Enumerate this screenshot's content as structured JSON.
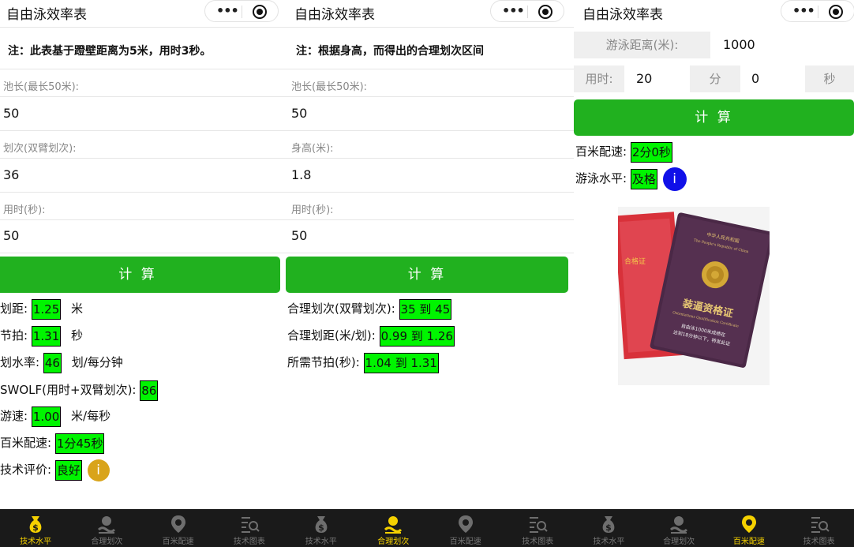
{
  "app_title": "自由泳效率表",
  "capsule": {
    "more_glyph": "•••"
  },
  "colors": {
    "accent_green": "#21b11f",
    "result_green": "#00f500",
    "tab_active": "#f5d100",
    "info_gold": "#d9a41a",
    "info_blue": "#1010e8"
  },
  "screen1": {
    "note": "注：此表基于蹬壁距离为5米，用时3秒。",
    "fields": [
      {
        "label": "池长(最长50米):",
        "value": "50"
      },
      {
        "label": "划次(双臂划次):",
        "value": "36"
      },
      {
        "label": "用时(秒):",
        "value": "50"
      }
    ],
    "button": "计 算",
    "results": [
      {
        "label": "划距:",
        "value": "1.25",
        "unit": "米"
      },
      {
        "label": "节拍:",
        "value": "1.31",
        "unit": "秒"
      },
      {
        "label": "划水率:",
        "value": "46",
        "unit": "划/每分钟"
      },
      {
        "label": "SWOLF(用时+双臂划次):",
        "value": "86",
        "unit": ""
      },
      {
        "label": "游速:",
        "value": "1.00",
        "unit": "米/每秒"
      },
      {
        "label": "百米配速:",
        "value": "1分45秒",
        "unit": ""
      },
      {
        "label": "技术评价:",
        "value": "良好",
        "unit": ""
      }
    ],
    "info_glyph": "i"
  },
  "screen2": {
    "note": "注：根据身高，而得出的合理划次区间",
    "fields": [
      {
        "label": "池长(最长50米):",
        "value": "50"
      },
      {
        "label": "身高(米):",
        "value": "1.8"
      },
      {
        "label": "用时(秒):",
        "value": "50"
      }
    ],
    "button": "计 算",
    "results": [
      {
        "label": "合理划次(双臂划次):",
        "value": "35 到 45"
      },
      {
        "label": "合理划距(米/划):",
        "value": "0.99 到 1.26"
      },
      {
        "label": "所需节拍(秒):",
        "value": "1.04 到 1.31"
      }
    ]
  },
  "screen3": {
    "distance_label": "游泳距离(米):",
    "distance_value": "1000",
    "time_label": "用时:",
    "minutes_value": "20",
    "minutes_unit": "分",
    "seconds_value": "0",
    "seconds_unit": "秒",
    "button": "计 算",
    "results": [
      {
        "label": "百米配速:",
        "value": "2分0秒"
      },
      {
        "label": "游泳水平:",
        "value": "及格"
      }
    ],
    "info_glyph": "i",
    "cert": {
      "red_book_text": "合格证",
      "header": "中华人民共和国",
      "subheader": "The People's Republic of China",
      "title": "装逼资格证",
      "title_en": "Ostentatious Qualification Certificate",
      "line1": "自由泳1000米成绩在",
      "line2": "达到18分钟以下，特发此证"
    }
  },
  "tabbar": {
    "tabs": [
      {
        "label": "技术水平",
        "icon": "money-bag-icon"
      },
      {
        "label": "合理划次",
        "icon": "swimmer-icon"
      },
      {
        "label": "百米配速",
        "icon": "location-pin-icon"
      },
      {
        "label": "技术图表",
        "icon": "list-search-icon"
      }
    ]
  }
}
